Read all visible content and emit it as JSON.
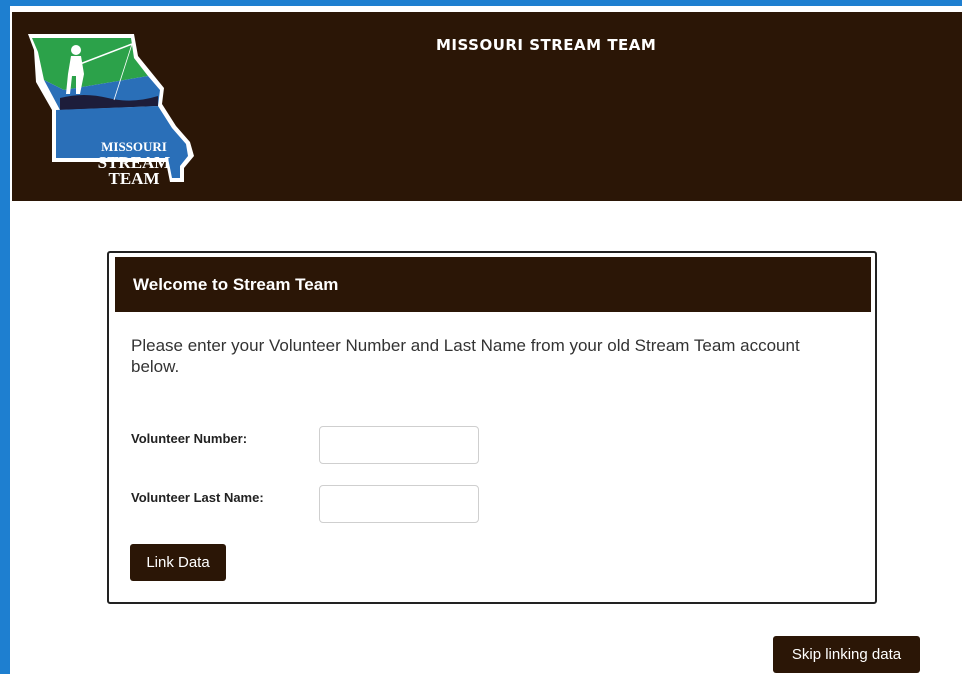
{
  "header": {
    "site_title": "MISSOURI STREAM TEAM",
    "logo_line1": "MISSOURI",
    "logo_line2": "STREAM",
    "logo_line3": "TEAM"
  },
  "panel": {
    "title": "Welcome to Stream Team",
    "instructions": "Please enter your Volunteer Number and Last Name from your old Stream Team account below.",
    "volunteer_number_label": "Volunteer Number:",
    "volunteer_number_value": "",
    "volunteer_last_name_label": "Volunteer Last Name:",
    "volunteer_last_name_value": "",
    "link_button": "Link Data"
  },
  "skip_button": "Skip linking data",
  "colors": {
    "brand_brown": "#2b1606",
    "frame_blue": "#1e7fd0",
    "logo_green": "#2ca24a",
    "logo_blue": "#2a6fb8"
  }
}
